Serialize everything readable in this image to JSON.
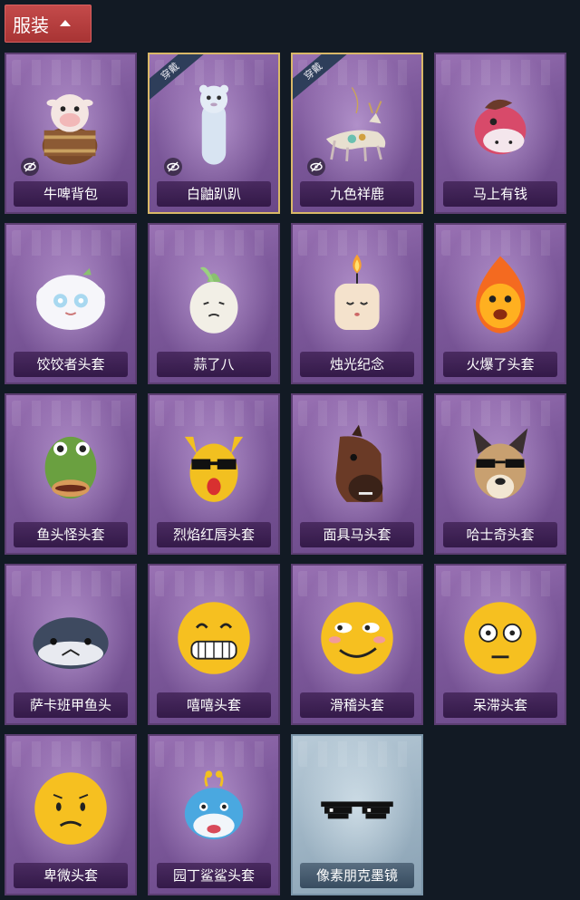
{
  "header": {
    "label": "服装"
  },
  "equipped_label": "穿戴",
  "items": [
    {
      "name": "牛啤背包",
      "icon": "cow-beer-backpack-icon",
      "equipped": false,
      "hidden": true,
      "rarity": "purple"
    },
    {
      "name": "白鼬趴趴",
      "icon": "white-weasel-icon",
      "equipped": true,
      "hidden": true,
      "rarity": "purple"
    },
    {
      "name": "九色祥鹿",
      "icon": "nine-color-deer-icon",
      "equipped": true,
      "hidden": true,
      "rarity": "purple"
    },
    {
      "name": "马上有钱",
      "icon": "horse-head-icon",
      "equipped": false,
      "hidden": false,
      "rarity": "purple"
    },
    {
      "name": "饺饺者头套",
      "icon": "dumpling-head-icon",
      "equipped": false,
      "hidden": false,
      "rarity": "purple"
    },
    {
      "name": "蒜了八",
      "icon": "garlic-head-icon",
      "equipped": false,
      "hidden": false,
      "rarity": "purple"
    },
    {
      "name": "烛光纪念",
      "icon": "candle-head-icon",
      "equipped": false,
      "hidden": false,
      "rarity": "purple"
    },
    {
      "name": "火爆了头套",
      "icon": "fire-head-icon",
      "equipped": false,
      "hidden": false,
      "rarity": "purple"
    },
    {
      "name": "鱼头怪头套",
      "icon": "fish-head-icon",
      "equipped": false,
      "hidden": false,
      "rarity": "purple"
    },
    {
      "name": "烈焰红唇头套",
      "icon": "red-lips-mask-icon",
      "equipped": false,
      "hidden": false,
      "rarity": "purple"
    },
    {
      "name": "面具马头套",
      "icon": "horse-mask-icon",
      "equipped": false,
      "hidden": false,
      "rarity": "purple"
    },
    {
      "name": "哈士奇头套",
      "icon": "husky-head-icon",
      "equipped": false,
      "hidden": false,
      "rarity": "purple"
    },
    {
      "name": "萨卡班甲鱼头",
      "icon": "sacabambaspis-head-icon",
      "equipped": false,
      "hidden": false,
      "rarity": "purple"
    },
    {
      "name": "嘻嘻头套",
      "icon": "grin-emoji-head-icon",
      "equipped": false,
      "hidden": false,
      "rarity": "purple"
    },
    {
      "name": "滑稽头套",
      "icon": "funny-emoji-head-icon",
      "equipped": false,
      "hidden": false,
      "rarity": "purple"
    },
    {
      "name": "呆滞头套",
      "icon": "dazed-emoji-head-icon",
      "equipped": false,
      "hidden": false,
      "rarity": "purple"
    },
    {
      "name": "卑微头套",
      "icon": "humble-emoji-head-icon",
      "equipped": false,
      "hidden": false,
      "rarity": "purple"
    },
    {
      "name": "园丁鲨鲨头套",
      "icon": "gardener-shark-head-icon",
      "equipped": false,
      "hidden": false,
      "rarity": "purple"
    },
    {
      "name": "像素朋克墨镜",
      "icon": "pixel-sunglasses-icon",
      "equipped": false,
      "hidden": false,
      "rarity": "silver"
    }
  ]
}
